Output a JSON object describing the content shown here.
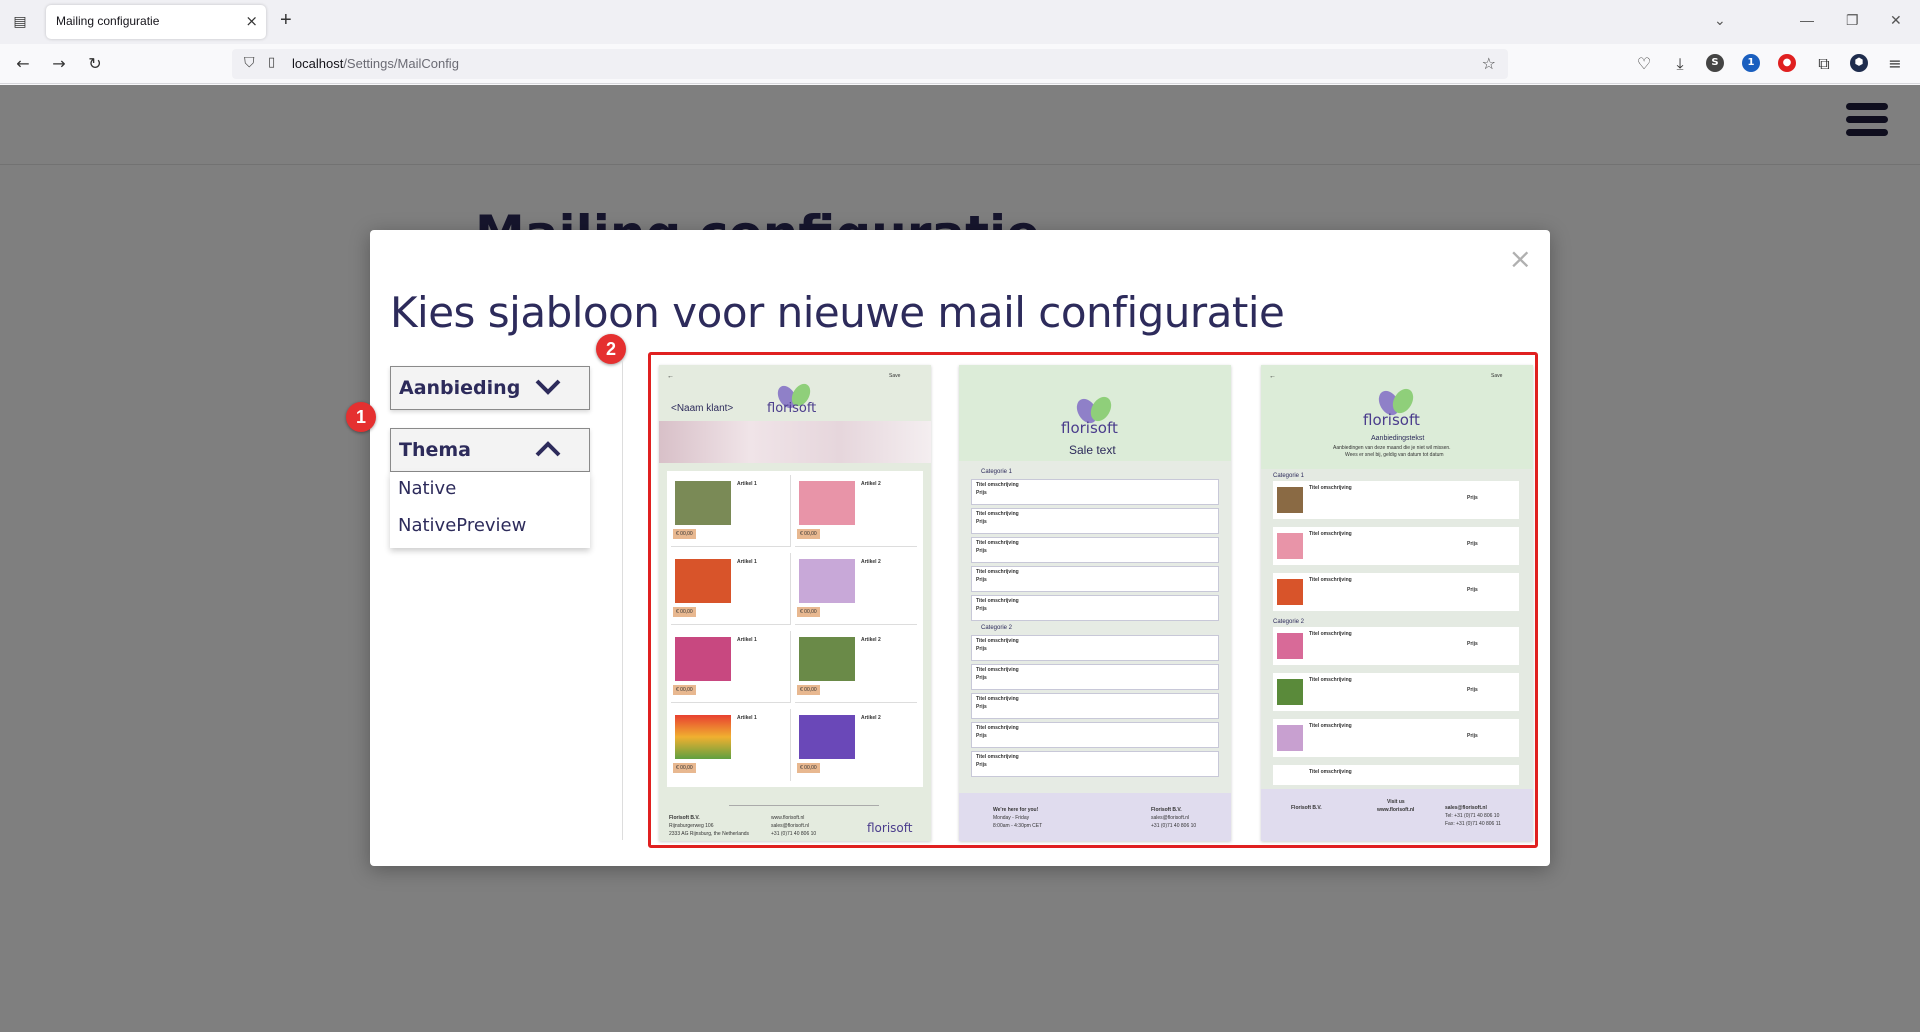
{
  "browser": {
    "tab_title": "Mailing configuratie",
    "url_host": "localhost",
    "url_path": "/Settings/MailConfig"
  },
  "page": {
    "title": "Mailing configuratie"
  },
  "modal": {
    "title": "Kies sjabloon voor nieuwe mail configuratie",
    "close": "×",
    "dropdowns": [
      {
        "label": "Aanbieding",
        "state": "collapsed"
      },
      {
        "label": "Thema",
        "state": "expanded"
      }
    ],
    "theme_options": [
      "Native",
      "NativePreview"
    ]
  },
  "annotations": [
    "1",
    "2"
  ],
  "templates": [
    {
      "name_placeholder": "<Naam klant>",
      "logo": "florisoft",
      "save": "Save",
      "articles": [
        "Artikel 1",
        "Artikel 2",
        "Artikel 1",
        "Artikel 2",
        "Artikel 1",
        "Artikel 2",
        "Artikel 1",
        "Artikel 2"
      ],
      "price": "€ 00,00",
      "footer_company": "Florisoft B.V.",
      "footer_address": "Rijnsburgerweg 106",
      "footer_city": "2333 AG Rijnsburg, the Netherlands",
      "footer_web": "www.florisoft.nl",
      "footer_mail": "sales@florisoft.nl",
      "footer_tel": "+31 (0)71 40 806 10"
    },
    {
      "logo": "florisoft",
      "sale_text": "Sale text",
      "categories": [
        "Categorie 1",
        "Categorie 2"
      ],
      "row_title": "Titel omschrijving",
      "row_price": "Prijs",
      "footer_left": "We're here for you!",
      "footer_days": "Monday - Friday",
      "footer_hours": "8:00am - 4:30pm CET",
      "footer_company": "Florisoft B.V.",
      "footer_mail": "sales@florisoft.nl",
      "footer_tel": "+31 (0)71 40 806 10"
    },
    {
      "logo": "florisoft",
      "save": "Save",
      "heading": "Aanbiedingstekst",
      "subheading": "Aanbiedingen van deze maand die je niet wil missen.",
      "subheading2": "Wees er snel bij, geldig van datum tot datum",
      "categories": [
        "Categorie 1",
        "Categorie 2"
      ],
      "row_title": "Titel omschrijving",
      "row_price": "Prijs",
      "footer_company": "Florisoft B.V.",
      "footer_visit": "Visit us",
      "footer_web": "www.florisoft.nl",
      "footer_mail": "sales@florisoft.nl",
      "footer_tel": "Tel: +31 (0)71 40 806 10",
      "footer_fax": "Fax: +31 (0)71 40 806 11"
    }
  ],
  "colors": {
    "brand": "#2d2b5b",
    "annotation": "#e53030",
    "price_tag": "#e8b890",
    "leaf_green": "#8fcf7a",
    "leaf_purple": "#8f80c8"
  }
}
